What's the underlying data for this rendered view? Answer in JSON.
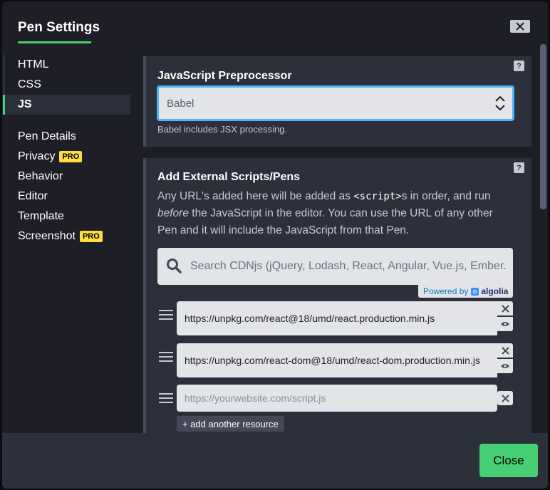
{
  "header": {
    "title": "Pen Settings",
    "close_icon": "close-icon"
  },
  "sidebar": {
    "group1": [
      {
        "label": "HTML",
        "active": false
      },
      {
        "label": "CSS",
        "active": false
      },
      {
        "label": "JS",
        "active": true
      }
    ],
    "group2": [
      {
        "label": "Pen Details",
        "pro": ""
      },
      {
        "label": "Privacy",
        "pro": "PRO"
      },
      {
        "label": "Behavior",
        "pro": ""
      },
      {
        "label": "Editor",
        "pro": ""
      },
      {
        "label": "Template",
        "pro": ""
      },
      {
        "label": "Screenshot",
        "pro": "PRO"
      }
    ]
  },
  "preprocessor": {
    "title": "JavaScript Preprocessor",
    "help": "?",
    "selected": "Babel",
    "help_text": "Babel includes JSX processing."
  },
  "external": {
    "title": "Add External Scripts/Pens",
    "help": "?",
    "desc_1": "Any URL's added here will be added as ",
    "desc_code": "<script>",
    "desc_2": "s in order, and run ",
    "desc_em": "before",
    "desc_3": " the JavaScript in the editor. You can use the URL of any other Pen and it will include the JavaScript from that Pen.",
    "search_placeholder": "Search CDNjs (jQuery, Lodash, React, Angular, Vue.js, Ember.",
    "powered_by": "Powered by",
    "algolia": "algolia",
    "resources": [
      "https://unpkg.com/react@18/umd/react.production.min.js",
      "https://unpkg.com/react-dom@18/umd/react-dom.production.min.js"
    ],
    "new_resource_placeholder": "https://yourwebsite.com/script.js",
    "add_label": "+ add another resource"
  },
  "footer": {
    "close_label": "Close",
    "accent": "#47cf73"
  }
}
